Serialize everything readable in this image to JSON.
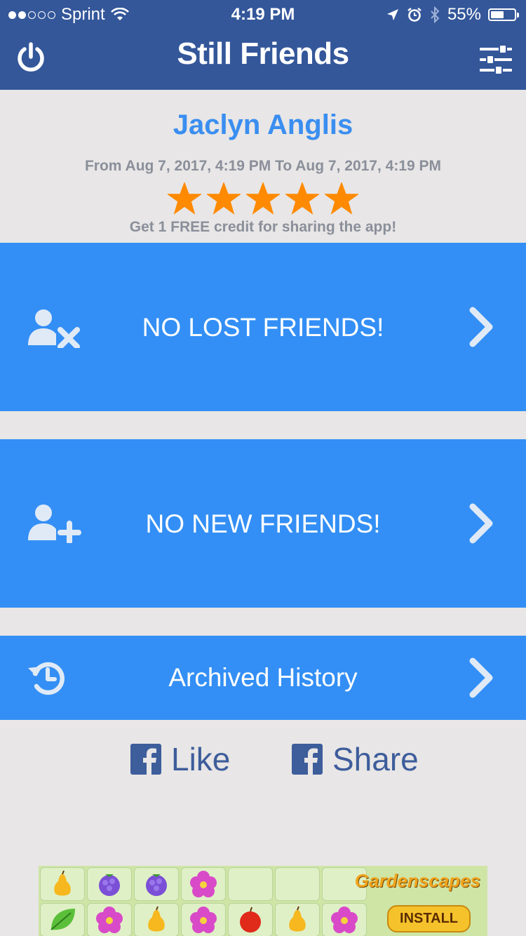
{
  "status_bar": {
    "carrier": "Sprint",
    "time": "4:19 PM",
    "battery": "55%",
    "battery_level": 0.55
  },
  "nav": {
    "title": "Still Friends",
    "left_icon": "power-icon",
    "right_icon": "sliders-icon"
  },
  "profile": {
    "name": "Jaclyn Anglis",
    "date_range": "From Aug 7, 2017, 4:19 PM To Aug 7, 2017, 4:19 PM",
    "rating": 5,
    "rating_max": 5,
    "credit_text": "Get 1 FREE credit for sharing the app!"
  },
  "panels": [
    {
      "label": "NO LOST FRIENDS!",
      "icon": "user-remove-icon"
    },
    {
      "label": "NO NEW FRIENDS!",
      "icon": "user-add-icon"
    },
    {
      "label": "Archived History",
      "icon": "history-icon"
    }
  ],
  "social": {
    "like": "Like",
    "share": "Share"
  },
  "ad": {
    "brand": "Gardenscapes",
    "cta": "INSTALL"
  },
  "colors": {
    "nav_bg": "#34579a",
    "accent_blue": "#338ff5",
    "name_blue": "#3a8ef0",
    "star_orange": "#ff8a00",
    "background": "#e8e6e6",
    "facebook": "#3d5d9b"
  }
}
